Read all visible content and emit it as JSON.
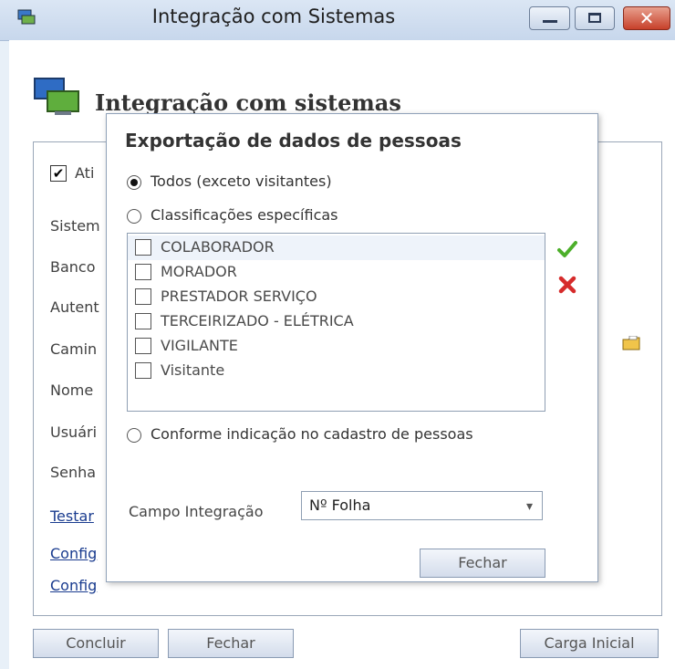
{
  "window": {
    "title": "Integração com Sistemas",
    "close_glyph": "✕"
  },
  "page": {
    "heading": "Integração com sistemas"
  },
  "background_form": {
    "check_label": "Ati",
    "check_mark": "✔",
    "labels": [
      "Sistem",
      "Banco",
      "Autent",
      "Camin",
      "Nome",
      "Usuári",
      "Senha"
    ],
    "links": [
      "Testar",
      "Config",
      "Config"
    ]
  },
  "dialog": {
    "title": "Exportação de dados de pessoas",
    "radio_all": "Todos (exceto visitantes)",
    "radio_specific": "Classificações específicas",
    "radio_conforme": "Conforme indicação no cadastro de pessoas",
    "classifications": [
      "COLABORADOR",
      "MORADOR",
      "PRESTADOR SERVIÇO",
      "TERCEIRIZADO - ELÉTRICA",
      "VIGILANTE",
      "Visitante"
    ],
    "field_label": "Campo Integração",
    "field_value": "Nº Folha",
    "close_button": "Fechar"
  },
  "footer": {
    "concluir": "Concluir",
    "fechar": "Fechar",
    "carga_inicial": "Carga Inicial"
  },
  "icons": {
    "app": "computer-icon",
    "confirm": "check-icon",
    "remove": "red-x-icon",
    "folder": "folder-icon",
    "dropdown": "chevron-down-icon"
  },
  "colors": {
    "accent": "#1a3c8f",
    "check_green": "#4caf2a",
    "remove_red": "#d62b2b",
    "close_button": "#c7402a"
  }
}
